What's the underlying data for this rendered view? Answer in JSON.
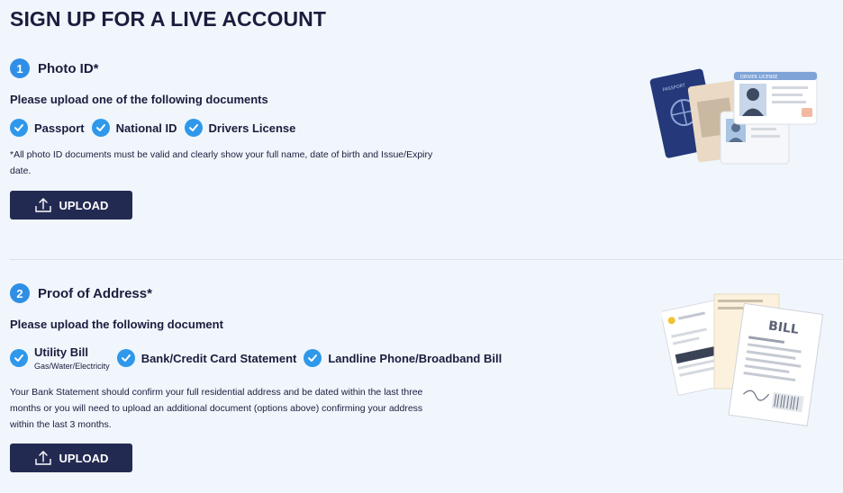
{
  "page": {
    "title": "SIGN UP FOR A LIVE ACCOUNT"
  },
  "colors": {
    "accent": "#2f8fe6",
    "button": "#232a52",
    "background": "#f0f6fc"
  },
  "photo_id": {
    "step": "1",
    "title": "Photo ID*",
    "subheading": "Please upload one of the following documents",
    "documents": [
      {
        "label": "Passport",
        "icon": "check-circle-icon"
      },
      {
        "label": "National ID",
        "icon": "check-circle-icon"
      },
      {
        "label": "Drivers License",
        "icon": "check-circle-icon"
      }
    ],
    "note_line1": "*All photo ID documents must be valid and clearly show your full name, date of birth and Issue/Expiry",
    "note_line2": "date.",
    "upload_label": "UPLOAD",
    "upload_icon": "upload-icon",
    "illustration": {
      "passport_text": "PASSPORT",
      "license_header": "DRIVER LICENSE"
    }
  },
  "proof_of_address": {
    "step": "2",
    "title": "Proof of Address*",
    "subheading": "Please upload the following document",
    "documents": [
      {
        "label": "Utility Bill",
        "sublabel": "Gas/Water/Electricity",
        "icon": "check-circle-icon"
      },
      {
        "label": "Bank/Credit Card Statement",
        "icon": "check-circle-icon"
      },
      {
        "label": "Landline Phone/Broadband Bill",
        "icon": "check-circle-icon"
      }
    ],
    "note_line1": "Your Bank Statement should confirm your full residential address and be dated within the last three",
    "note_line2": "months or you will need to upload an additional document (options above) confirming your address",
    "note_line3": "within the last 3 months.",
    "upload_label": "UPLOAD",
    "upload_icon": "upload-icon",
    "illustration": {
      "bill_text": "BILL"
    }
  }
}
